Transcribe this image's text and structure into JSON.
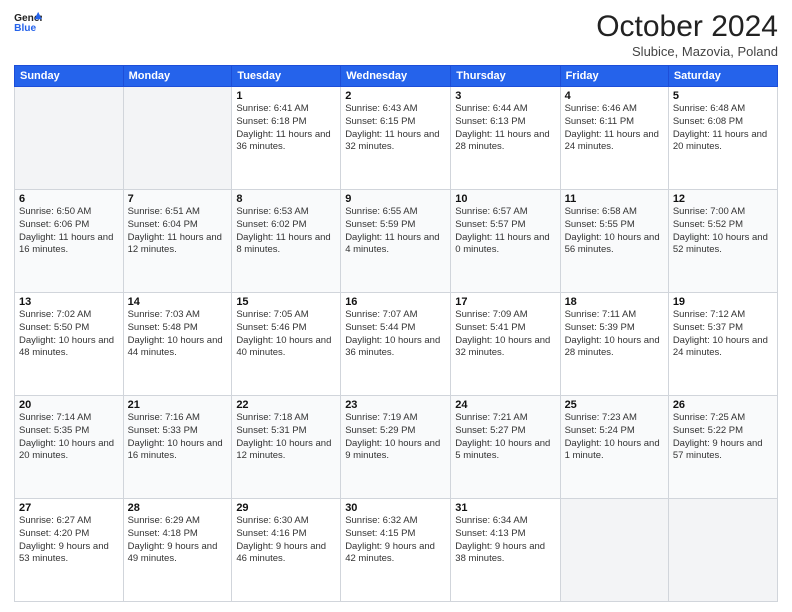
{
  "header": {
    "logo_line1": "General",
    "logo_line2": "Blue",
    "month_title": "October 2024",
    "location": "Slubice, Mazovia, Poland"
  },
  "days_of_week": [
    "Sunday",
    "Monday",
    "Tuesday",
    "Wednesday",
    "Thursday",
    "Friday",
    "Saturday"
  ],
  "weeks": [
    [
      null,
      null,
      {
        "day": 1,
        "sunrise": "6:41 AM",
        "sunset": "6:18 PM",
        "daylight": "11 hours and 36 minutes."
      },
      {
        "day": 2,
        "sunrise": "6:43 AM",
        "sunset": "6:15 PM",
        "daylight": "11 hours and 32 minutes."
      },
      {
        "day": 3,
        "sunrise": "6:44 AM",
        "sunset": "6:13 PM",
        "daylight": "11 hours and 28 minutes."
      },
      {
        "day": 4,
        "sunrise": "6:46 AM",
        "sunset": "6:11 PM",
        "daylight": "11 hours and 24 minutes."
      },
      {
        "day": 5,
        "sunrise": "6:48 AM",
        "sunset": "6:08 PM",
        "daylight": "11 hours and 20 minutes."
      }
    ],
    [
      {
        "day": 6,
        "sunrise": "6:50 AM",
        "sunset": "6:06 PM",
        "daylight": "11 hours and 16 minutes."
      },
      {
        "day": 7,
        "sunrise": "6:51 AM",
        "sunset": "6:04 PM",
        "daylight": "11 hours and 12 minutes."
      },
      {
        "day": 8,
        "sunrise": "6:53 AM",
        "sunset": "6:02 PM",
        "daylight": "11 hours and 8 minutes."
      },
      {
        "day": 9,
        "sunrise": "6:55 AM",
        "sunset": "5:59 PM",
        "daylight": "11 hours and 4 minutes."
      },
      {
        "day": 10,
        "sunrise": "6:57 AM",
        "sunset": "5:57 PM",
        "daylight": "11 hours and 0 minutes."
      },
      {
        "day": 11,
        "sunrise": "6:58 AM",
        "sunset": "5:55 PM",
        "daylight": "10 hours and 56 minutes."
      },
      {
        "day": 12,
        "sunrise": "7:00 AM",
        "sunset": "5:52 PM",
        "daylight": "10 hours and 52 minutes."
      }
    ],
    [
      {
        "day": 13,
        "sunrise": "7:02 AM",
        "sunset": "5:50 PM",
        "daylight": "10 hours and 48 minutes."
      },
      {
        "day": 14,
        "sunrise": "7:03 AM",
        "sunset": "5:48 PM",
        "daylight": "10 hours and 44 minutes."
      },
      {
        "day": 15,
        "sunrise": "7:05 AM",
        "sunset": "5:46 PM",
        "daylight": "10 hours and 40 minutes."
      },
      {
        "day": 16,
        "sunrise": "7:07 AM",
        "sunset": "5:44 PM",
        "daylight": "10 hours and 36 minutes."
      },
      {
        "day": 17,
        "sunrise": "7:09 AM",
        "sunset": "5:41 PM",
        "daylight": "10 hours and 32 minutes."
      },
      {
        "day": 18,
        "sunrise": "7:11 AM",
        "sunset": "5:39 PM",
        "daylight": "10 hours and 28 minutes."
      },
      {
        "day": 19,
        "sunrise": "7:12 AM",
        "sunset": "5:37 PM",
        "daylight": "10 hours and 24 minutes."
      }
    ],
    [
      {
        "day": 20,
        "sunrise": "7:14 AM",
        "sunset": "5:35 PM",
        "daylight": "10 hours and 20 minutes."
      },
      {
        "day": 21,
        "sunrise": "7:16 AM",
        "sunset": "5:33 PM",
        "daylight": "10 hours and 16 minutes."
      },
      {
        "day": 22,
        "sunrise": "7:18 AM",
        "sunset": "5:31 PM",
        "daylight": "10 hours and 12 minutes."
      },
      {
        "day": 23,
        "sunrise": "7:19 AM",
        "sunset": "5:29 PM",
        "daylight": "10 hours and 9 minutes."
      },
      {
        "day": 24,
        "sunrise": "7:21 AM",
        "sunset": "5:27 PM",
        "daylight": "10 hours and 5 minutes."
      },
      {
        "day": 25,
        "sunrise": "7:23 AM",
        "sunset": "5:24 PM",
        "daylight": "10 hours and 1 minute."
      },
      {
        "day": 26,
        "sunrise": "7:25 AM",
        "sunset": "5:22 PM",
        "daylight": "9 hours and 57 minutes."
      }
    ],
    [
      {
        "day": 27,
        "sunrise": "6:27 AM",
        "sunset": "4:20 PM",
        "daylight": "9 hours and 53 minutes."
      },
      {
        "day": 28,
        "sunrise": "6:29 AM",
        "sunset": "4:18 PM",
        "daylight": "9 hours and 49 minutes."
      },
      {
        "day": 29,
        "sunrise": "6:30 AM",
        "sunset": "4:16 PM",
        "daylight": "9 hours and 46 minutes."
      },
      {
        "day": 30,
        "sunrise": "6:32 AM",
        "sunset": "4:15 PM",
        "daylight": "9 hours and 42 minutes."
      },
      {
        "day": 31,
        "sunrise": "6:34 AM",
        "sunset": "4:13 PM",
        "daylight": "9 hours and 38 minutes."
      },
      null,
      null
    ]
  ],
  "labels": {
    "sunrise": "Sunrise:",
    "sunset": "Sunset:",
    "daylight": "Daylight:"
  }
}
